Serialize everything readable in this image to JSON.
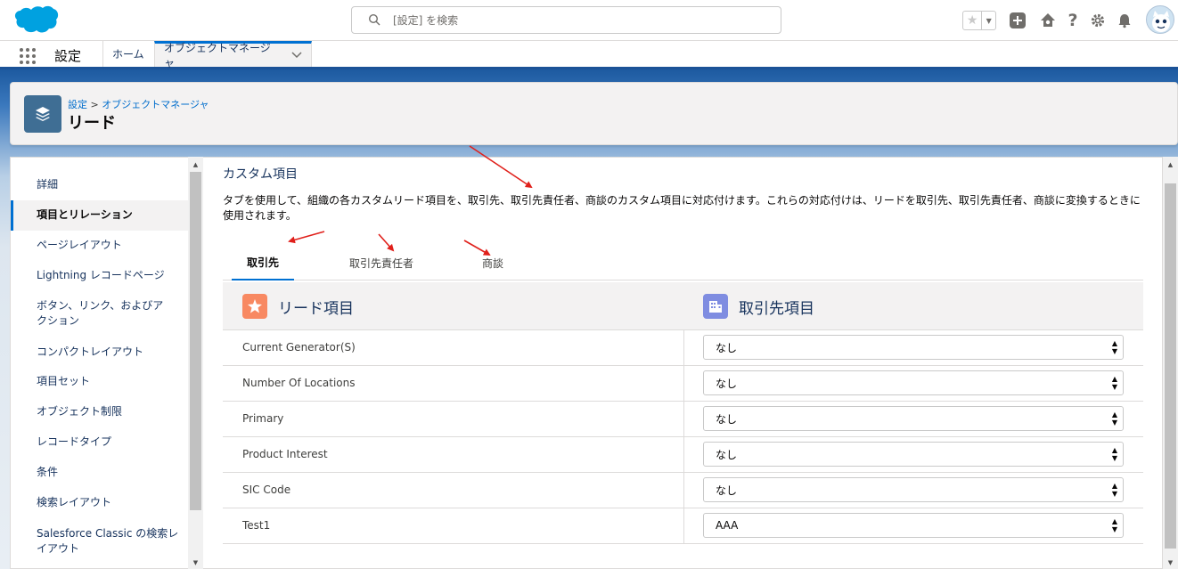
{
  "header": {
    "search_placeholder": "[設定] を検索",
    "icons": [
      "star-icon",
      "add-icon",
      "trailhead-icon",
      "help-icon",
      "gear-icon",
      "bell-icon",
      "avatar"
    ]
  },
  "context_bar": {
    "app_name": "設定",
    "tabs": [
      {
        "label": "ホーム",
        "active": false
      },
      {
        "label": "オブジェクトマネージャ",
        "active": true
      }
    ]
  },
  "page_header": {
    "breadcrumb_root": "設定",
    "breadcrumb_sep": ">",
    "breadcrumb_current": "オブジェクトマネージャ",
    "title": "リード"
  },
  "sidebar": {
    "items": [
      {
        "label": "詳細",
        "active": false
      },
      {
        "label": "項目とリレーション",
        "active": true
      },
      {
        "label": "ページレイアウト",
        "active": false
      },
      {
        "label": "Lightning レコードページ",
        "active": false
      },
      {
        "label": "ボタン、リンク、およびア\nクション",
        "active": false
      },
      {
        "label": "コンパクトレイアウト",
        "active": false
      },
      {
        "label": "項目セット",
        "active": false
      },
      {
        "label": "オブジェクト制限",
        "active": false
      },
      {
        "label": "レコードタイプ",
        "active": false
      },
      {
        "label": "条件",
        "active": false
      },
      {
        "label": "検索レイアウト",
        "active": false
      },
      {
        "label": "Salesforce Classic の検索レ\nイアウト",
        "active": false
      }
    ]
  },
  "main": {
    "section_title": "カスタム項目",
    "description": "タブを使用して、組織の各カスタムリード項目を、取引先、取引先責任者、商談のカスタム項目に対応付けます。これらの対応付けは、リードを取引先、取引先責任者、商談に変換するときに使用されます。",
    "tabs": [
      {
        "label": "取引先",
        "active": true
      },
      {
        "label": "取引先責任者",
        "active": false
      },
      {
        "label": "商談",
        "active": false
      }
    ],
    "table": {
      "lead_header": "リード項目",
      "target_header": "取引先項目",
      "rows": [
        {
          "lead_field": "Current Generator(S)",
          "mapped": "なし"
        },
        {
          "lead_field": "Number Of Locations",
          "mapped": "なし"
        },
        {
          "lead_field": "Primary",
          "mapped": "なし"
        },
        {
          "lead_field": "Product Interest",
          "mapped": "なし"
        },
        {
          "lead_field": "SIC Code",
          "mapped": "なし"
        },
        {
          "lead_field": "Test1",
          "mapped": "AAA"
        }
      ]
    }
  },
  "colors": {
    "brand_blue": "#0070d2",
    "band_blue": "#1b5297",
    "lead_icon": "#f88962",
    "account_icon": "#7f8de1",
    "annotation_red": "#e0201b"
  }
}
